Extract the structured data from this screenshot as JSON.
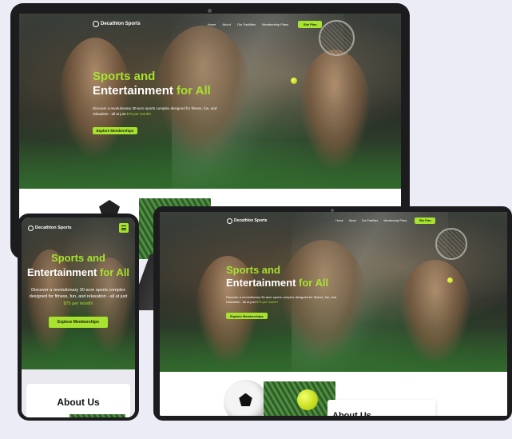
{
  "site": {
    "brand": "Decathlon Sports",
    "nav_links": [
      "Home",
      "About",
      "Our Facilities",
      "Membership Plans"
    ],
    "nav_cta": "Site Plan",
    "headline_line1": "Sports and",
    "headline_white": "Entertainment",
    "headline_green": "for All",
    "subtext": "Discover a revolutionary 30-acre sports complex designed for fitness, fun, and relaxation - all at just",
    "price": "$75 per month!",
    "cta": "Explore Memberships",
    "about_title": "About Us"
  },
  "colors": {
    "accent": "#a6e22e",
    "device_frame": "#1c1c1e",
    "page_background": "#ececf7"
  },
  "icons": {
    "logo": "decathlon-logo-icon",
    "menu": "hamburger-menu-icon",
    "camera": "camera-dot-icon"
  }
}
